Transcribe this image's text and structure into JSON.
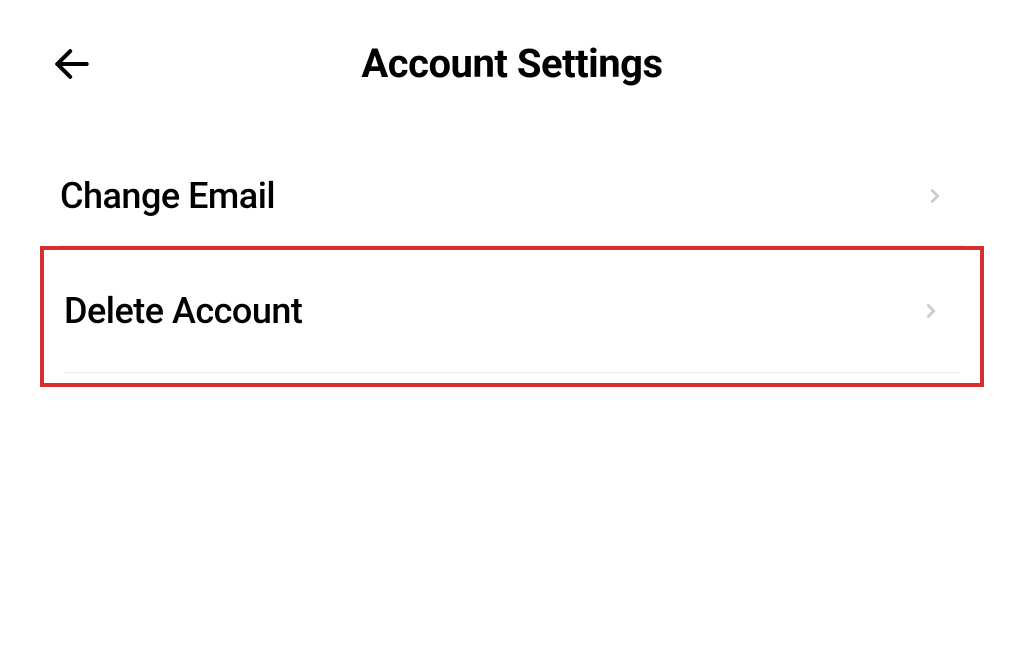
{
  "header": {
    "title": "Account Settings"
  },
  "settings": {
    "change_email": {
      "label": "Change Email"
    },
    "delete_account": {
      "label": "Delete Account"
    }
  }
}
